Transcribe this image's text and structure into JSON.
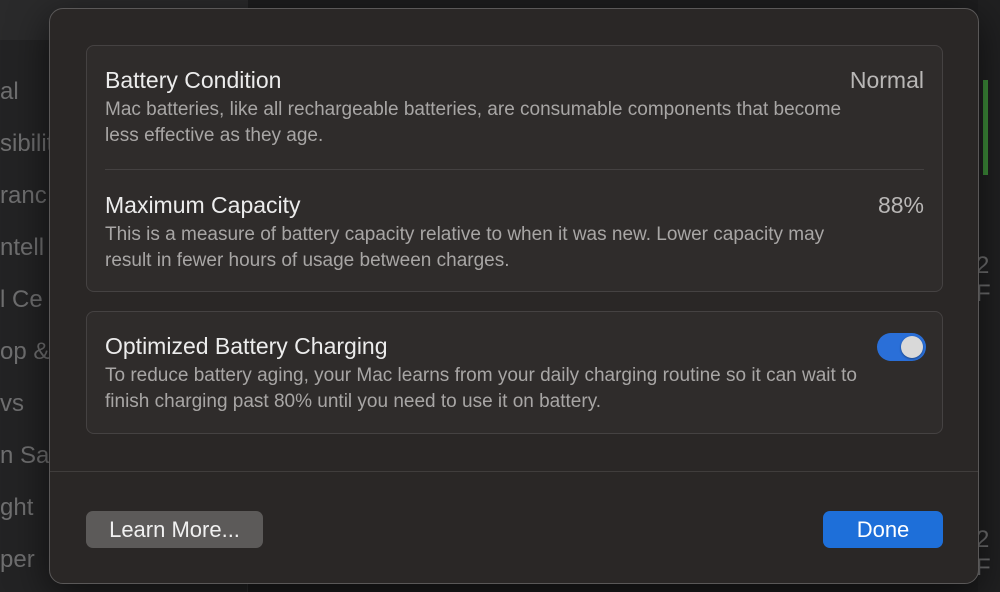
{
  "background": {
    "sidebar_fragments": [
      "al",
      "sibilit",
      "ranc",
      "ntell",
      "l Ce",
      "op &",
      "vs",
      "n Sav",
      "ght",
      "per"
    ],
    "right_edge_fragments": [
      "2 F",
      "2 F"
    ]
  },
  "sheet": {
    "battery_condition": {
      "title": "Battery Condition",
      "value": "Normal",
      "description": "Mac batteries, like all rechargeable batteries, are consumable components that become less effective as they age."
    },
    "maximum_capacity": {
      "title": "Maximum Capacity",
      "value": "88%",
      "description": "This is a measure of battery capacity relative to when it was new. Lower capacity may result in fewer hours of usage between charges."
    },
    "optimized_charging": {
      "title": "Optimized Battery Charging",
      "description": "To reduce battery aging, your Mac learns from your daily charging routine so it can wait to finish charging past 80% until you need to use it on battery.",
      "enabled": true
    },
    "buttons": {
      "learn_more": "Learn More...",
      "done": "Done"
    }
  },
  "colors": {
    "accent": "#1e6fd9",
    "toggle_on": "#2a6fd8",
    "sheet_bg": "#2a2726"
  }
}
